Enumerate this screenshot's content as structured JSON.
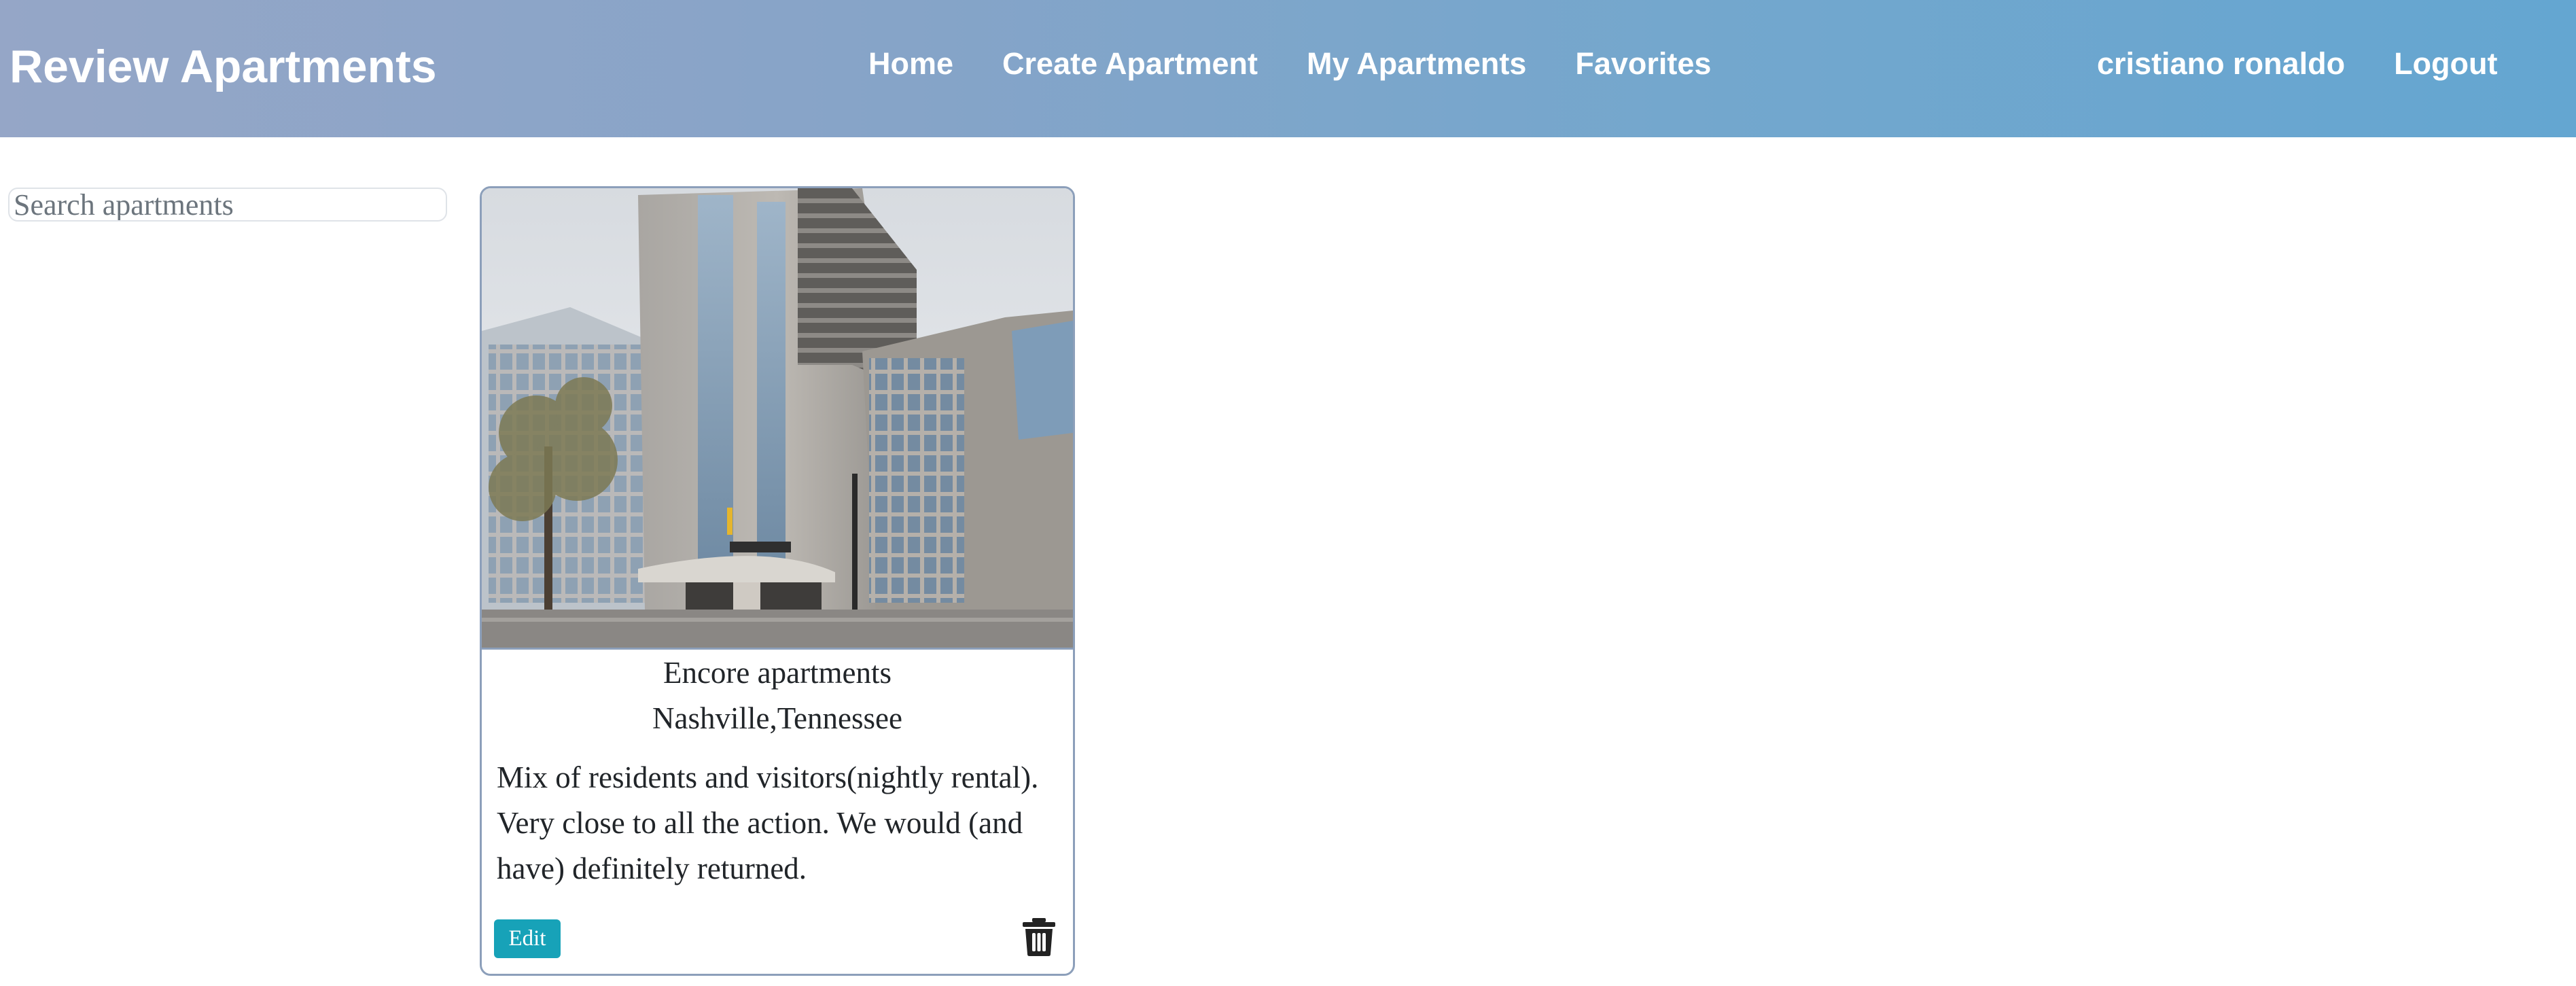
{
  "navbar": {
    "brand": "Review Apartments",
    "links": [
      "Home",
      "Create Apartment",
      "My Apartments",
      "Favorites"
    ],
    "user_name": "cristiano ronaldo",
    "logout": "Logout",
    "colors": {
      "gradient_start": "#95a6c7",
      "gradient_end": "#64a6d1",
      "text": "#ffffff"
    }
  },
  "search": {
    "placeholder": "Search apartments",
    "value": ""
  },
  "apartments": [
    {
      "image_alt": "apartment building photo",
      "title": "Encore apartments",
      "location": "Nashville,Tennessee",
      "description": "Mix of residents and visitors(nightly rental). Very close to all the action. We would (and have) definitely returned.",
      "edit_label": "Edit",
      "delete_icon": "trash-icon"
    }
  ],
  "colors": {
    "card_border": "#8c9fba",
    "edit_button": "#17a2b8",
    "text": "#212529"
  }
}
